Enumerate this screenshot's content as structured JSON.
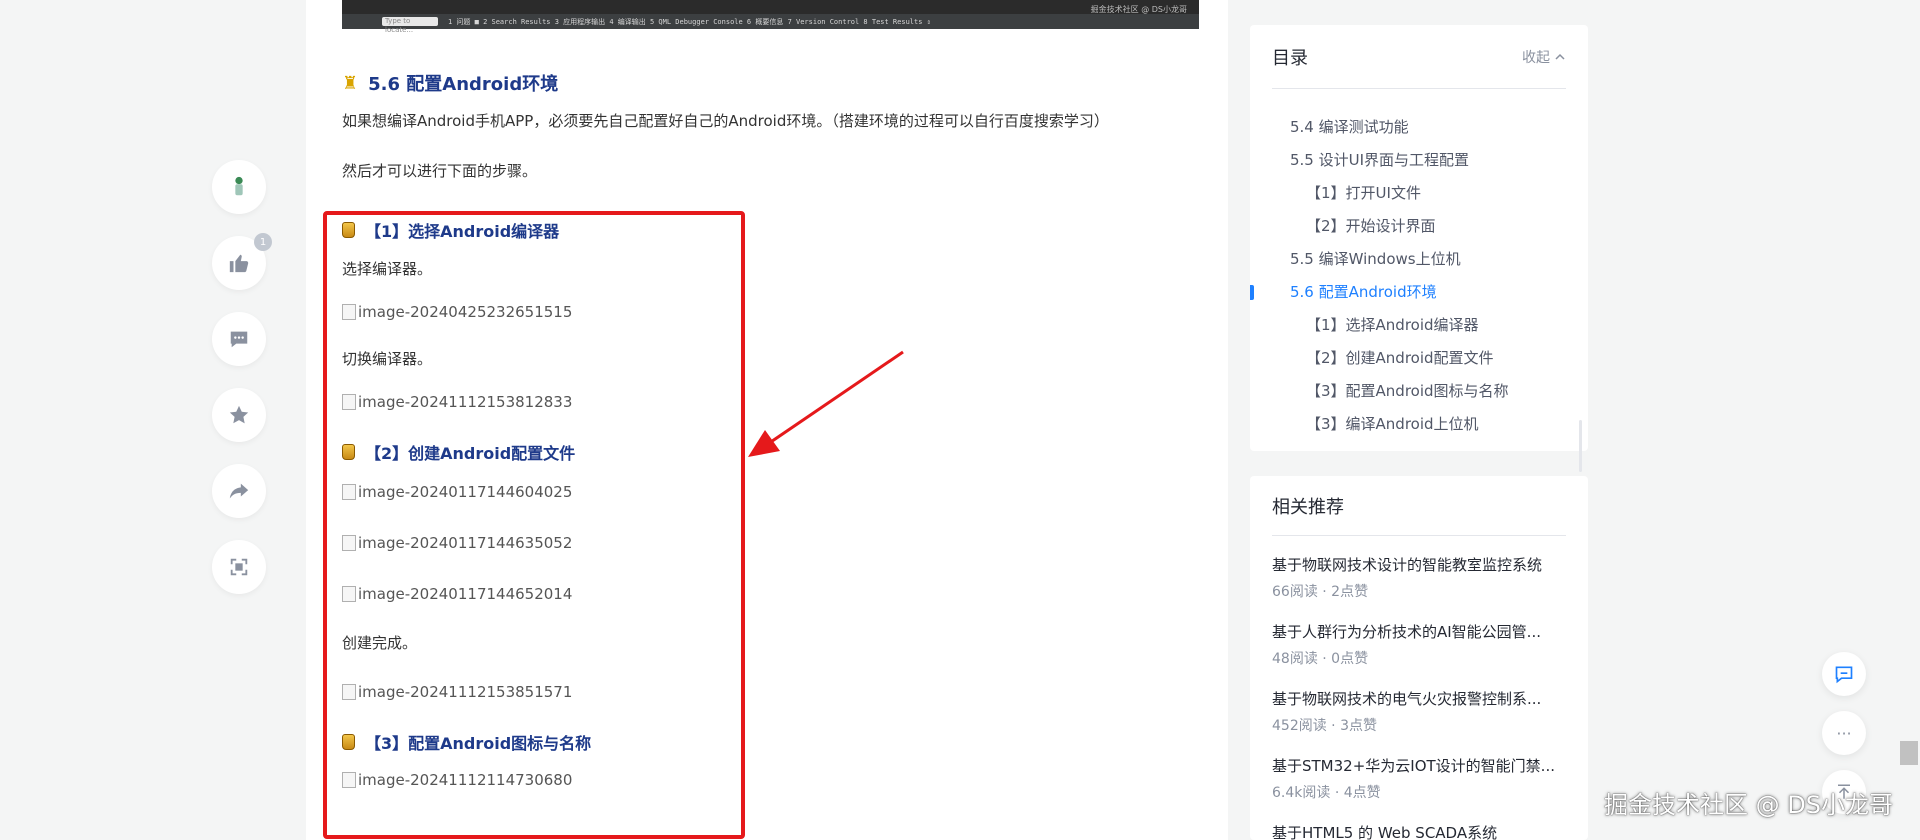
{
  "rail": {
    "like_count": "1"
  },
  "code_screenshot": {
    "locate_placeholder": "Type to locate...",
    "tool_tabs": "1 问题 ■  2 Search Results  3 应用程序输出  4 编译输出  5 QML Debugger Console  6 概要信息  7 Version Control  8 Test Results  ⇕",
    "watermark": "掘金技术社区 @ DS小龙哥"
  },
  "article": {
    "section_title": "5.6 配置Android环境",
    "section_emoji": "♜",
    "intro": "如果想编译Android手机APP，必须要先自己配置好自己的Android环境。（搭建环境的过程可以自行百度搜索学习）",
    "then": "然后才可以进行下面的步骤。",
    "step1_title": "【1】选择Android编译器",
    "step1_text": "选择编译器。",
    "img1": "image-20240425232651515",
    "step1_switch": "切换编译器。",
    "img2": "image-20241112153812833",
    "step2_title": "【2】创建Android配置文件",
    "img3": "image-20240117144604025",
    "img4": "image-20240117144635052",
    "img5": "image-20240117144652014",
    "step2_done": "创建完成。",
    "img6": "image-20241112153851571",
    "step3_title": "【3】配置Android图标与名称",
    "img7": "image-20241112114730680"
  },
  "toc": {
    "title": "目录",
    "toggle": "收起",
    "items": [
      {
        "label": "5.4 编译测试功能",
        "level": 1
      },
      {
        "label": "5.5 设计UI界面与工程配置",
        "level": 1
      },
      {
        "label": "【1】打开UI文件",
        "level": 2
      },
      {
        "label": "【2】开始设计界面",
        "level": 2
      },
      {
        "label": "5.5 编译Windows上位机",
        "level": 1
      },
      {
        "label": "5.6 配置Android环境",
        "level": 1,
        "active": true
      },
      {
        "label": "【1】选择Android编译器",
        "level": 2
      },
      {
        "label": "【2】创建Android配置文件",
        "level": 2
      },
      {
        "label": "【3】配置Android图标与名称",
        "level": 2
      },
      {
        "label": "【3】编译Android上位机",
        "level": 2
      }
    ]
  },
  "related": {
    "title": "相关推荐",
    "items": [
      {
        "title": "基于物联网技术设计的智能教室监控系统",
        "meta": "66阅读 · 2点赞"
      },
      {
        "title": "基于人群行为分析技术的AI智能公园管...",
        "meta": "48阅读 · 0点赞"
      },
      {
        "title": "基于物联网技术的电气火灾报警控制系...",
        "meta": "452阅读 · 3点赞"
      },
      {
        "title": "基于STM32+华为云IOT设计的智能门禁...",
        "meta": "6.4k阅读 · 4点赞"
      },
      {
        "title": "基于HTML5 的 Web SCADA系统",
        "meta": ""
      }
    ]
  },
  "floating": {
    "more": "···"
  },
  "watermark": "掘金技术社区 @ DS小龙哥",
  "colors": {
    "accent": "#1e80ff",
    "heading": "#1e3a8a",
    "annotation_red": "#e5191b"
  }
}
